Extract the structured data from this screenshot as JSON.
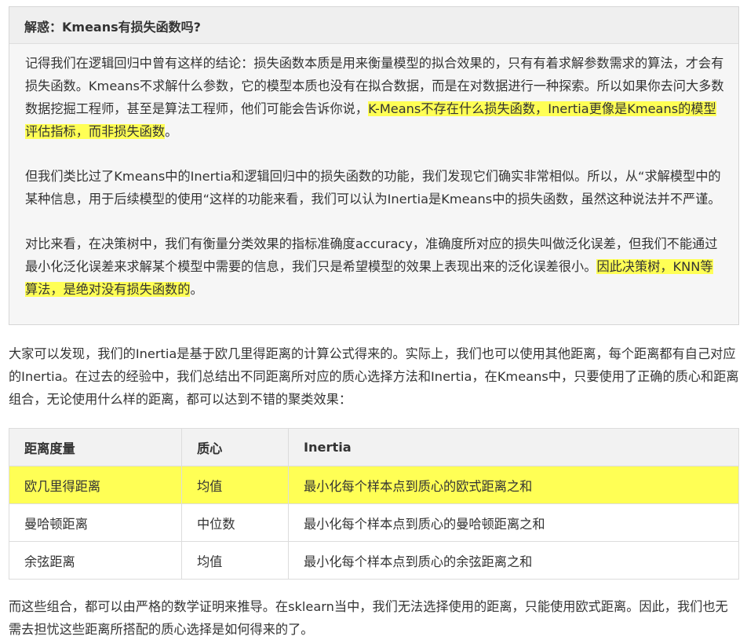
{
  "callout": {
    "title": "解惑：Kmeans有损失函数吗?",
    "p1_a": "记得我们在逻辑回归中曾有这样的结论：损失函数本质是用来衡量模型的拟合效果的，只有有着求解参数需求的算法，才会有损失函数。Kmeans不求解什么参数，它的模型本质也没有在拟合数据，而是在对数据进行一种探索。所以如果你去问大多数数据挖掘工程师，甚至是算法工程师，他们可能会告诉你说，",
    "p1_hl": "K-Means不存在什么损失函数，Inertia更像是Kmeans的模型评估指标，而非损失函数",
    "p1_end": "。",
    "p2": "但我们类比过了Kmeans中的Inertia和逻辑回归中的损失函数的功能，我们发现它们确实非常相似。所以，从“求解模型中的某种信息，用于后续模型的使用“这样的功能来看，我们可以认为Inertia是Kmeans中的损失函数，虽然这种说法并不严谨。",
    "p3_a": "对比来看，在决策树中，我们有衡量分类效果的指标准确度accuracy，准确度所对应的损失叫做泛化误差，但我们不能通过最小化泛化误差来求解某个模型中需要的信息，我们只是希望模型的效果上表现出来的泛化误差很小。",
    "p3_hl": "因此决策树，KNN等算法，是绝对没有损失函数的",
    "p3_end": "。"
  },
  "para1": "大家可以发现，我们的Inertia是基于欧几里得距离的计算公式得来的。实际上，我们也可以使用其他距离，每个距离都有自己对应的Inertia。在过去的经验中，我们总结出不同距离所对应的质心选择方法和Inertia，在Kmeans中，只要使用了正确的质心和距离组合，无论使用什么样的距离，都可以达到不错的聚类效果：",
  "table": {
    "headers": [
      "距离度量",
      "质心",
      "Inertia"
    ],
    "rows": [
      [
        "欧几里得距离",
        "均值",
        "最小化每个样本点到质心的欧式距离之和"
      ],
      [
        "曼哈顿距离",
        "中位数",
        "最小化每个样本点到质心的曼哈顿距离之和"
      ],
      [
        "余弦距离",
        "均值",
        "最小化每个样本点到质心的余弦距离之和"
      ]
    ],
    "highlight_color": "#ffff55"
  },
  "para2": "而这些组合，都可以由严格的数学证明来推导。在sklearn当中，我们无法选择使用的距离，只能使用欧式距离。因此，我们也无需去担忧这些距离所搭配的质心选择是如何得来的了。"
}
